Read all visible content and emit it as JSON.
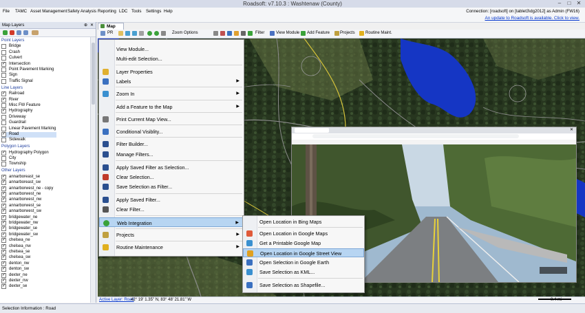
{
  "window": {
    "title": "Roadsoft: v7.10.3   :   Washtenaw (County)"
  },
  "menu": {
    "items": [
      "File",
      "TAMC",
      "Asset Management",
      "Safety Analysis",
      "Reporting",
      "LDC",
      "Tools",
      "Settings",
      "Help"
    ],
    "connection": "Connection: [roadsoft] on [tablet3\\dg2012] as Admin (FW16)",
    "update_link": "An update to Roadsoft is available. Click to view."
  },
  "left_panel": {
    "title": "Map Layers",
    "groups": [
      {
        "name": "Point Layers",
        "layers": [
          {
            "name": "Bridge",
            "checked": false
          },
          {
            "name": "Crash",
            "checked": false
          },
          {
            "name": "Culvert",
            "checked": false
          },
          {
            "name": "Intersection",
            "checked": true
          },
          {
            "name": "Point Pavement Marking",
            "checked": false
          },
          {
            "name": "Sign",
            "checked": false
          },
          {
            "name": "Traffic Signal",
            "checked": false
          }
        ]
      },
      {
        "name": "Line Layers",
        "layers": [
          {
            "name": "Railroad",
            "checked": true
          },
          {
            "name": "River",
            "checked": true
          },
          {
            "name": "Misc FW Feature",
            "checked": false
          },
          {
            "name": "Hydrography",
            "checked": true
          },
          {
            "name": "Driveway",
            "checked": false
          },
          {
            "name": "Guardrail",
            "checked": false
          },
          {
            "name": "Linear Pavement Marking",
            "checked": false
          },
          {
            "name": "Road",
            "checked": true,
            "selected": true
          },
          {
            "name": "Sidewalk",
            "checked": false
          }
        ]
      },
      {
        "name": "Polygon Layers",
        "layers": [
          {
            "name": "Hydrography Polygon",
            "checked": true
          },
          {
            "name": "City",
            "checked": false
          },
          {
            "name": "Township",
            "checked": false
          }
        ]
      },
      {
        "name": "Other Layers",
        "layers": [
          {
            "name": "annarboreast_se",
            "checked": true
          },
          {
            "name": "annarboreast_sw",
            "checked": true
          },
          {
            "name": "annarborwest_ne - copy",
            "checked": true
          },
          {
            "name": "annarborwest_ne",
            "checked": true
          },
          {
            "name": "annarborwest_nw",
            "checked": true
          },
          {
            "name": "annarborwest_se",
            "checked": true
          },
          {
            "name": "annarborwest_sw",
            "checked": true
          },
          {
            "name": "bridgewater_ne",
            "checked": true
          },
          {
            "name": "bridgewater_nw",
            "checked": true
          },
          {
            "name": "bridgewater_se",
            "checked": true
          },
          {
            "name": "bridgewater_sw",
            "checked": true
          },
          {
            "name": "chelsea_ne",
            "checked": true
          },
          {
            "name": "chelsea_nw",
            "checked": true
          },
          {
            "name": "chelsea_se",
            "checked": true
          },
          {
            "name": "chelsea_sw",
            "checked": true
          },
          {
            "name": "denton_nw",
            "checked": true
          },
          {
            "name": "denton_sw",
            "checked": true
          },
          {
            "name": "dexter_ne",
            "checked": true
          },
          {
            "name": "dexter_nw",
            "checked": true
          },
          {
            "name": "dexter_se",
            "checked": true
          }
        ]
      }
    ]
  },
  "map_tab": {
    "label": "Map"
  },
  "map_toolbar": {
    "pr_label": "PR",
    "zoom_options": "Zoom Options",
    "filter": "Filter",
    "view_module": "View Module",
    "add_feature": "Add Feature",
    "projects": "Projects",
    "routine_maint": "Routine Maint."
  },
  "context_menu": {
    "items": [
      {
        "label": "View Module...",
        "icon": "none",
        "arrow": false
      },
      {
        "label": "Multi-edit Selection...",
        "icon": "none",
        "arrow": false
      },
      {
        "label": "Layer Properties",
        "icon": "layers-icon",
        "arrow": false
      },
      {
        "label": "Labels",
        "icon": "labels-icon",
        "arrow": true
      },
      {
        "label": "Zoom In",
        "icon": "zoom-in-icon",
        "arrow": true
      },
      {
        "label": "Add a Feature to the Map",
        "icon": "none",
        "arrow": true
      },
      {
        "label": "Print Current Map View...",
        "icon": "printer-icon",
        "arrow": false
      },
      {
        "label": "Conditional Visiblity...",
        "icon": "search-icon",
        "arrow": false
      },
      {
        "label": "Filter Builder...",
        "icon": "filter-icon",
        "arrow": false
      },
      {
        "label": "Manage Filters...",
        "icon": "manage-filters-icon",
        "arrow": false
      },
      {
        "label": "Apply Saved Filter as Selection...",
        "icon": "filter-icon",
        "arrow": false
      },
      {
        "label": "Clear Selection...",
        "icon": "clear-selection-icon",
        "arrow": false
      },
      {
        "label": "Save Selection as Filter...",
        "icon": "save-filter-icon",
        "arrow": false
      },
      {
        "label": "Apply Saved Filter...",
        "icon": "filter-icon",
        "arrow": false
      },
      {
        "label": "Clear Filter...",
        "icon": "clear-filter-icon",
        "arrow": false
      },
      {
        "label": "Web Integration",
        "icon": "globe-icon",
        "arrow": true,
        "highlighted": true
      },
      {
        "label": "Projects",
        "icon": "projects-icon",
        "arrow": true
      },
      {
        "label": "Routine Maintenance",
        "icon": "routine-maintenance-icon",
        "arrow": true
      }
    ]
  },
  "web_submenu": {
    "items": [
      {
        "label": "Open Location in Bing Maps",
        "icon": "none"
      },
      {
        "label": "Open Location in Google Maps",
        "icon": "google-maps-icon"
      },
      {
        "label": "Get a Printable Google Map",
        "icon": "printable-map-icon"
      },
      {
        "label": "Open Location in Google Street View",
        "icon": "street-view-icon",
        "highlighted": true
      },
      {
        "label": "Open Selection in Google Earth",
        "icon": "google-earth-icon"
      },
      {
        "label": "Save Selection as KML...",
        "icon": "kml-icon"
      },
      {
        "label": "Save Selection as Shapefile...",
        "icon": "shapefile-icon"
      }
    ]
  },
  "status_bar": {
    "active_layer": "Active Layer: Road",
    "coords": "42° 19' 1.35\" N, 83° 48' 21.81\" W",
    "scale": "0.4 mi"
  },
  "selection_info": "Selection Information : Road",
  "colors": {
    "water": "#1536c4",
    "menu_highlight": "#b7d5f2",
    "link": "#0033cc"
  }
}
